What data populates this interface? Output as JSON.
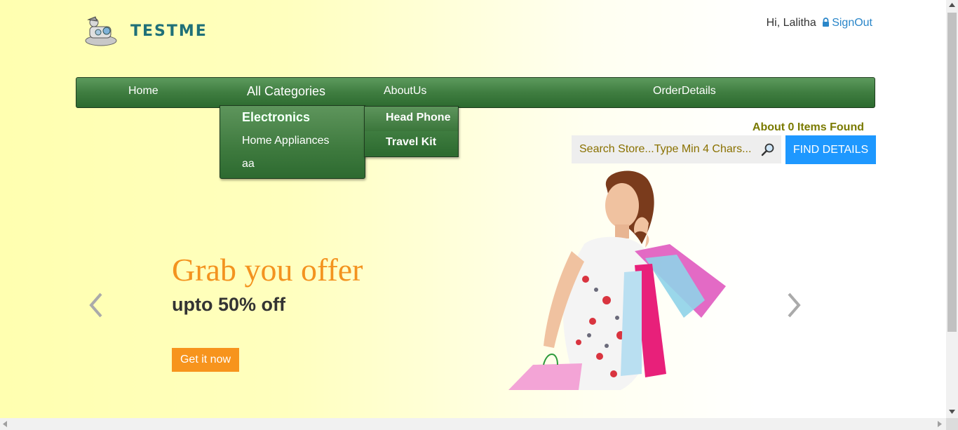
{
  "header": {
    "logo_text": "TESTME",
    "greeting": "Hi, Lalitha",
    "signout_label": "SignOut"
  },
  "nav": {
    "items": [
      {
        "label": "Home"
      },
      {
        "label": "All Categories"
      },
      {
        "label": "AboutUs"
      },
      {
        "label": "OrderDetails"
      }
    ]
  },
  "categories_menu": {
    "items": [
      {
        "label": "Electronics"
      },
      {
        "label": "Home Appliances"
      },
      {
        "label": "aa"
      }
    ],
    "submenu": [
      {
        "label": "Head Phone"
      },
      {
        "label": "Travel Kit"
      }
    ]
  },
  "search": {
    "result_text": "About 0 Items Found",
    "placeholder": "Search Store...Type Min 4 Chars...",
    "value": "",
    "button_label": "FIND DETAILS"
  },
  "banner": {
    "title": "Grab you offer",
    "subtitle": "upto 50% off",
    "cta_label": "Get it now"
  },
  "colors": {
    "nav_green": "#3f7d40",
    "accent_orange": "#f7941d",
    "find_button": "#1e98ff",
    "logo_teal": "#1f7078",
    "link_blue": "#2a86c9"
  },
  "icons": [
    "logo-mark-icon",
    "lock-icon",
    "search-icon",
    "chevron-left-icon",
    "chevron-right-icon"
  ]
}
